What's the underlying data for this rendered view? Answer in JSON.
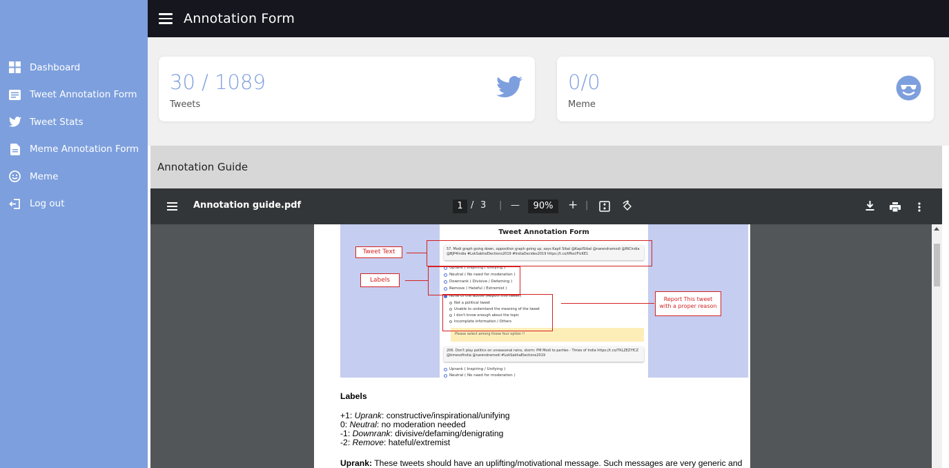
{
  "sidebar": {
    "items": [
      {
        "label": "Dashboard",
        "icon": "dashboard-icon"
      },
      {
        "label": "Tweet Annotation Form",
        "icon": "form-icon"
      },
      {
        "label": "Tweet Stats",
        "icon": "twitter-icon"
      },
      {
        "label": "Meme Annotation Form",
        "icon": "document-icon"
      },
      {
        "label": "Meme",
        "icon": "smiley-icon"
      },
      {
        "label": "Log out",
        "icon": "logout-icon"
      }
    ]
  },
  "header": {
    "title": "Annotation Form"
  },
  "cards": [
    {
      "value": "30 / 1089",
      "label": "Tweets",
      "icon": "twitter-icon"
    },
    {
      "value": "0/0",
      "label": "Meme",
      "icon": "sunglasses-smiley-icon"
    }
  ],
  "guide": {
    "title": "Annotation Guide"
  },
  "pdf": {
    "filename": "Annotation guide.pdf",
    "page_current": "1",
    "page_sep": "/",
    "page_total": "3",
    "zoom": "90%",
    "zoom_out": "—",
    "zoom_in": "+"
  },
  "screenshot": {
    "form_title": "Tweet Annotation Form",
    "tweet1": "57. Modi graph going down, opposition graph going up, says Kapil Sibal @KapilSibal @narendramodi @INCIndia @BJP4India #LokSabhaElections2019 #IndiaDecides2019 https://t.co/tMocIFlcKE1",
    "options": [
      "Uprank ( Inspiring / Unifying )",
      "Neutral ( No need for moderation )",
      "Downrank ( Divisive / Defaming )",
      "Remove ( Hateful / Extremist )",
      "None of the above (Report this tweet)"
    ],
    "sub_options": [
      "Not a political tweet",
      "Unable to understand the meaning of the tweet",
      "I don't know enough about the topic",
      "Incomplete information / Others"
    ],
    "warning": "Please select among these four option !!",
    "tweet2": "206. Don't play politics on unseasonal rains, storm: PM Modi to parties - Times of India https://t.co/TKLZEZYfCZ @timesofindia @narendramodi #LokSabhaElections2019",
    "options2": [
      "Uprank ( Inspiring / Unifying )",
      "Neutral ( No need for moderation )"
    ],
    "callout_tweet": "Tweet Text",
    "callout_labels": "Labels",
    "callout_report_1": "Report This tweet",
    "callout_report_2": "with a proper reason"
  },
  "doc": {
    "labels_heading": "Labels",
    "l1_prefix": "+1: ",
    "l1_term": "Uprank",
    "l1_desc": ": constructive/inspirational/unifying",
    "l2_prefix": "0: ",
    "l2_term": "Neutral",
    "l2_desc": ": no moderation needed",
    "l3_prefix": "-1: ",
    "l3_term": "Downrank",
    "l3_desc": ": divisive/defaming/denigrating",
    "l4_prefix": "-2: ",
    "l4_term": "Remove",
    "l4_desc": ": hateful/extremist",
    "uprank_term": "Uprank:",
    "uprank_text": " These tweets should have an uplifting/motivational message. Such messages are very generic and"
  },
  "colors": {
    "sidebar": "#7d9fdd",
    "topbar": "#16161e",
    "accent": "#7d9fdd",
    "pdf_toolbar": "#333638",
    "pdf_bg": "#525659",
    "callout_red": "#d42020"
  }
}
